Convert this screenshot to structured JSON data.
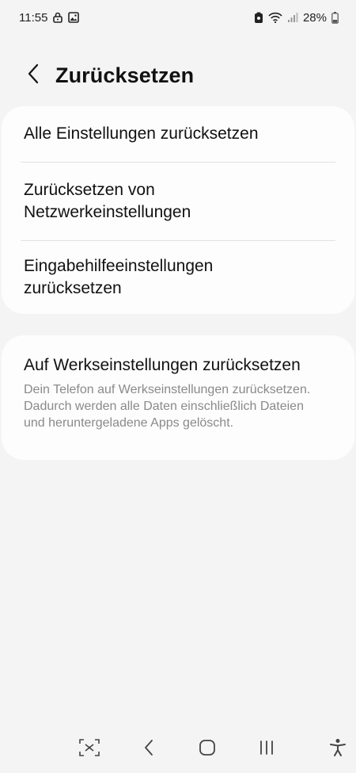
{
  "status_bar": {
    "time": "11:55",
    "battery": "28%",
    "icons": [
      "lock-icon",
      "image-icon",
      "vpn-icon",
      "wifi-icon",
      "signal-icon",
      "battery-icon"
    ]
  },
  "header": {
    "title": "Zurücksetzen",
    "back_icon": "chevron-left-icon"
  },
  "reset_options": [
    {
      "label": "Alle Einstellungen zurücksetzen"
    },
    {
      "label": "Zurücksetzen von Netzwerkeinstellungen"
    },
    {
      "label": "Eingabehilfeeinstellungen zurücksetzen"
    }
  ],
  "factory_reset": {
    "title": "Auf Werkseinstellungen zurücksetzen",
    "description": "Dein Telefon auf Werkseinstellungen zurücksetzen. Dadurch werden alle Daten einschließlich Dateien und heruntergeladene Apps gelöscht."
  },
  "nav_bar": {
    "icons": [
      "screenshot-icon",
      "back-icon",
      "home-icon",
      "recents-icon",
      "accessibility-icon"
    ]
  },
  "colors": {
    "background": "#f4f4f4",
    "card": "#fdfdfd",
    "secondary_text": "#8a8a8a"
  }
}
